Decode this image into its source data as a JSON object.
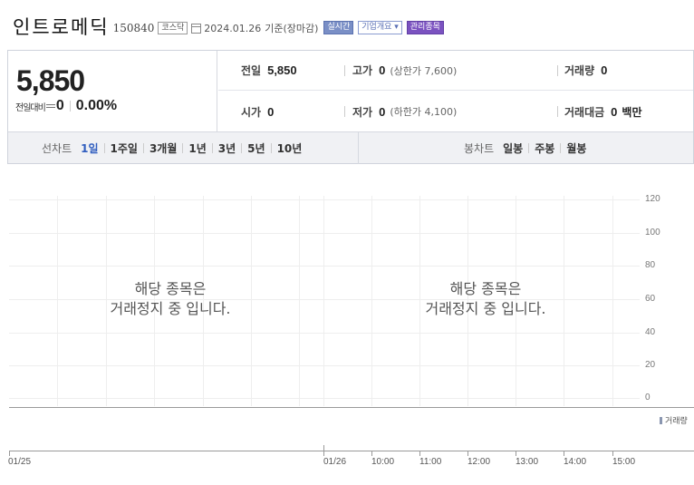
{
  "header": {
    "stock_name": "인트로메딕",
    "stock_code": "150840",
    "market": "코스닥",
    "date": "2024.01.26",
    "basis": "기준(장마감)",
    "badge_realtime": "실시간",
    "badge_company": "기업개요 ▾",
    "badge_managed": "관리종목"
  },
  "price": {
    "current": "5,850",
    "change_label": "전일대비",
    "change_value": "0",
    "change_rate": "0.00%",
    "prev_close_label": "전일",
    "prev_close": "5,850",
    "high_label": "고가",
    "high": "0",
    "upper_limit": "(상한가 7,600)",
    "volume_label": "거래량",
    "volume": "0",
    "open_label": "시가",
    "open": "0",
    "low_label": "저가",
    "low": "0",
    "lower_limit": "(하한가 4,100)",
    "amount_label": "거래대금",
    "amount": "0",
    "amount_unit": "백만"
  },
  "line_tabs": {
    "label": "선차트",
    "items": [
      "1일",
      "1주일",
      "3개월",
      "1년",
      "3년",
      "5년",
      "10년"
    ],
    "active": "1일"
  },
  "candle_tabs": {
    "label": "봉차트",
    "items": [
      "일봉",
      "주봉",
      "월봉"
    ]
  },
  "chart": {
    "halt_line1": "해당 종목은",
    "halt_line2": "거래정지 중 입니다.",
    "y_ticks": [
      "120",
      "100",
      "80",
      "60",
      "40",
      "20",
      "0"
    ],
    "x_ticks": [
      "01/25",
      "01/26",
      "10:00",
      "11:00",
      "12:00",
      "13:00",
      "14:00",
      "15:00"
    ],
    "volume_legend": "거래량"
  },
  "colors": {
    "active_tab": "#2f5dbf",
    "managed_badge": "#7b52c0",
    "realtime_badge": "#7a8fc6"
  }
}
